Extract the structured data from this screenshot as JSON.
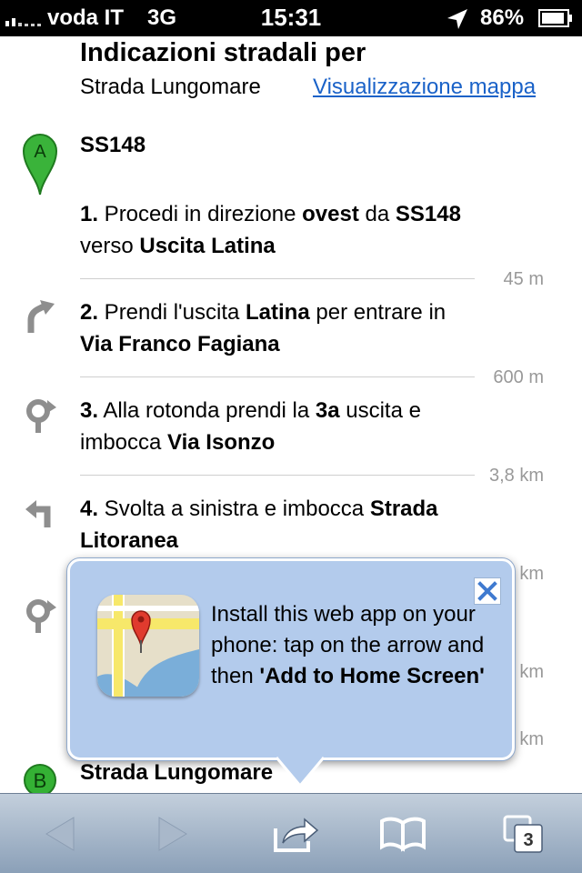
{
  "status_bar": {
    "carrier": "voda IT",
    "network": "3G",
    "time": "15:31",
    "battery_percent": "86%"
  },
  "header": {
    "title": "Indicazioni stradali per",
    "destination": "Strada Lungomare",
    "map_link": "Visualizzazione mappa"
  },
  "origin": {
    "marker": "A",
    "label": "SS148"
  },
  "steps": [
    {
      "number": "1.",
      "parts": [
        {
          "t": " Procedi in direzione "
        },
        {
          "t": "ovest",
          "b": true
        },
        {
          "t": " da "
        },
        {
          "t": "SS148",
          "b": true
        },
        {
          "t": " verso "
        },
        {
          "t": "Uscita Latina",
          "b": true
        }
      ],
      "distance": "45 m",
      "icon": "none"
    },
    {
      "number": "2.",
      "parts": [
        {
          "t": " Prendi l'uscita "
        },
        {
          "t": "Latina",
          "b": true
        },
        {
          "t": " per entrare in "
        },
        {
          "t": "Via Franco Fagiana",
          "b": true
        }
      ],
      "distance": "600 m",
      "icon": "ramp-right-icon"
    },
    {
      "number": "3.",
      "parts": [
        {
          "t": " Alla rotonda prendi la "
        },
        {
          "t": "3a",
          "b": true
        },
        {
          "t": " uscita e imbocca "
        },
        {
          "t": "Via Isonzo",
          "b": true
        }
      ],
      "distance": "3,8 km",
      "icon": "roundabout-icon"
    },
    {
      "number": "4.",
      "parts": [
        {
          "t": " Svolta a sinistra e imbocca "
        },
        {
          "t": "Strada Litoranea",
          "b": true
        }
      ],
      "distance": "km",
      "icon": "turn-left-icon"
    }
  ],
  "hidden_distances": [
    "km",
    "km"
  ],
  "destination": {
    "marker": "B",
    "label": "Strada Lungomare"
  },
  "popup": {
    "text_plain": "Install this web app on your phone: tap on the arrow and then ",
    "text_bold": "'Add to Home Screen'",
    "close": "×"
  },
  "toolbar": {
    "tabs_count": "3"
  },
  "colors": {
    "link": "#1a62c8",
    "popup_bg": "#b3cbec",
    "marker_a": "#3ab33a",
    "marker_b": "#34b134",
    "icon_gray": "#8e8e8e"
  }
}
